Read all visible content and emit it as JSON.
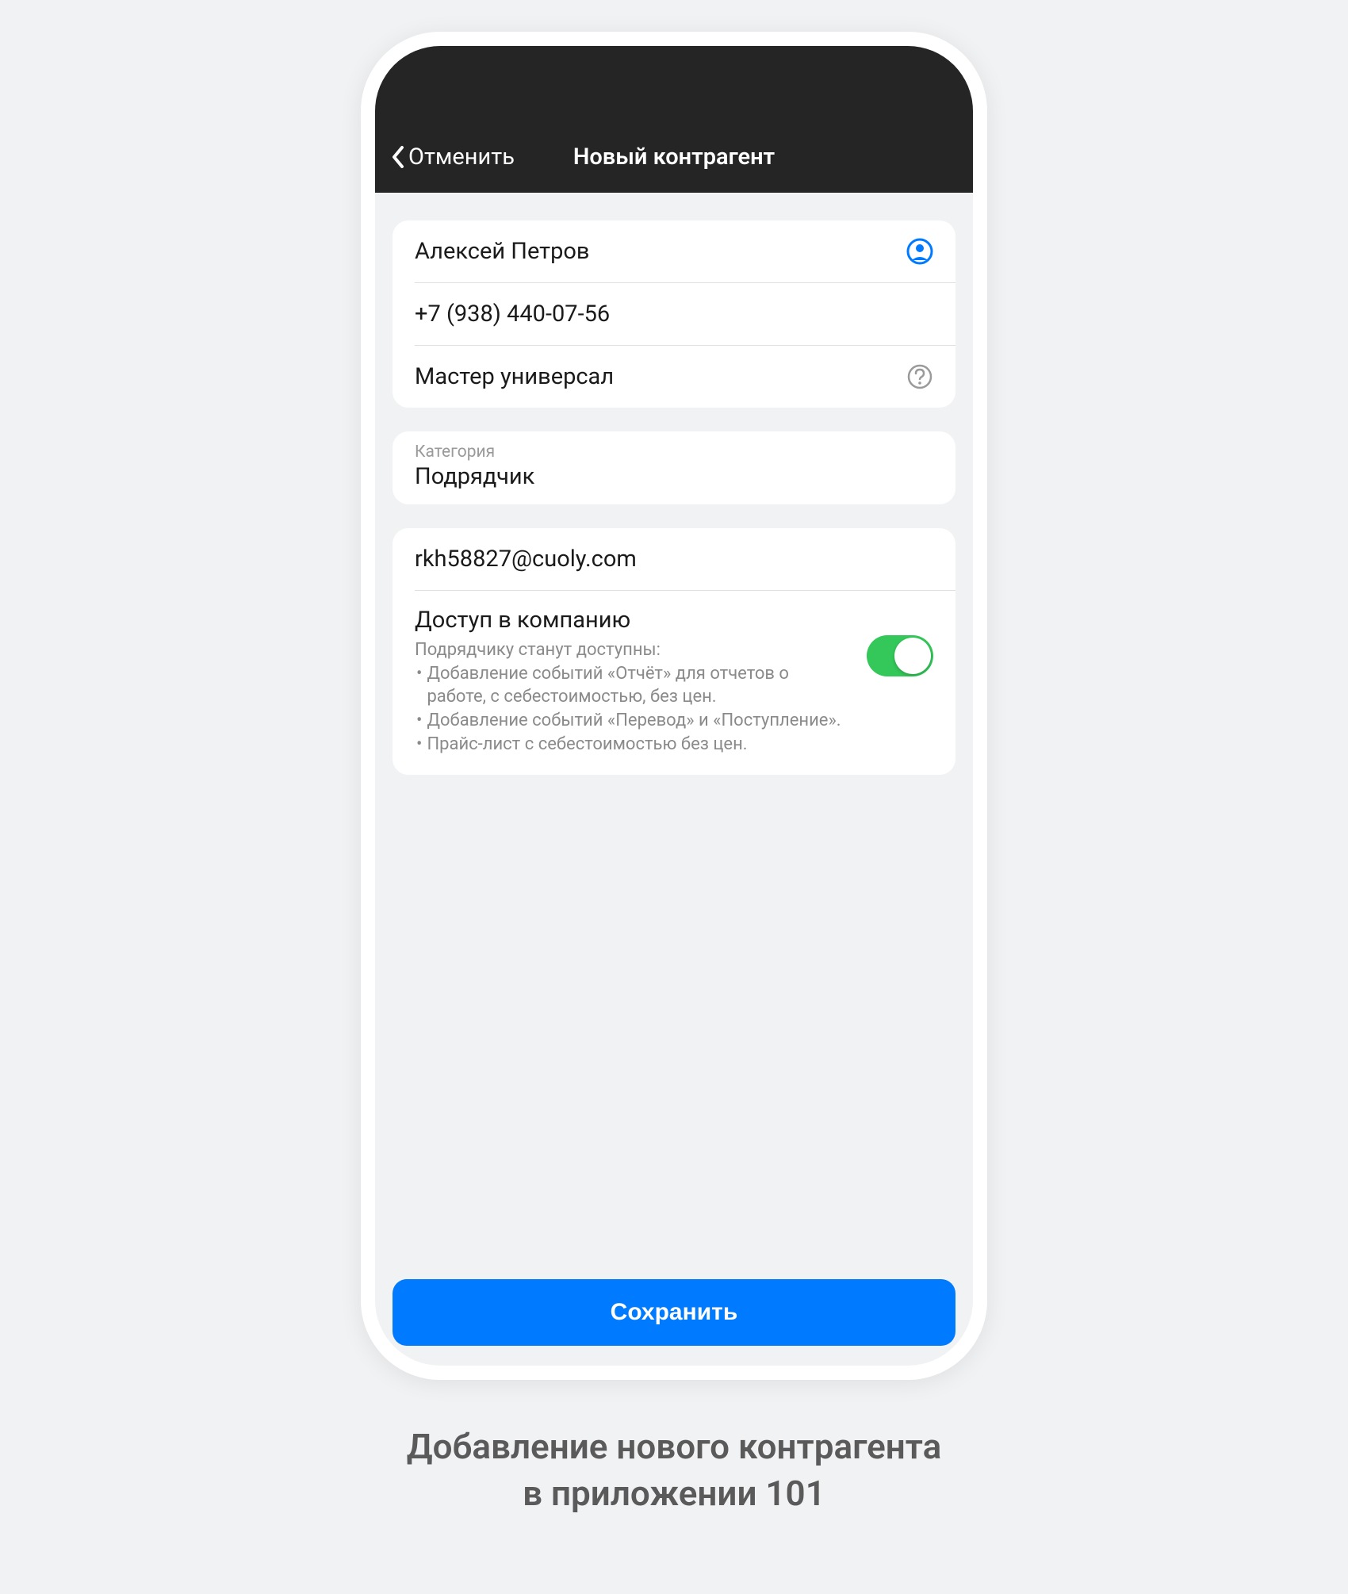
{
  "nav": {
    "back_label": "Отменить",
    "title": "Новый контрагент"
  },
  "form": {
    "name": "Алексей Петров",
    "phone": "+7 (938) 440-07-56",
    "role": "Мастер универсал",
    "category_label": "Категория",
    "category_value": "Подрядчик",
    "email": "rkh58827@cuoly.com",
    "access_title": "Доступ в компанию",
    "access_intro": "Подрядчику станут доступны:",
    "access_bullets": [
      "Добавление событий «Отчёт» для отчетов о работе, с себестоимостью, без цен.",
      "Добавление событий «Перевод» и «Поступление».",
      "Прайс-лист с себестоимостью без цен."
    ],
    "access_enabled": true
  },
  "actions": {
    "save_label": "Сохранить"
  },
  "caption_line1": "Добавление нового контрагента",
  "caption_line2": "в приложении 101"
}
